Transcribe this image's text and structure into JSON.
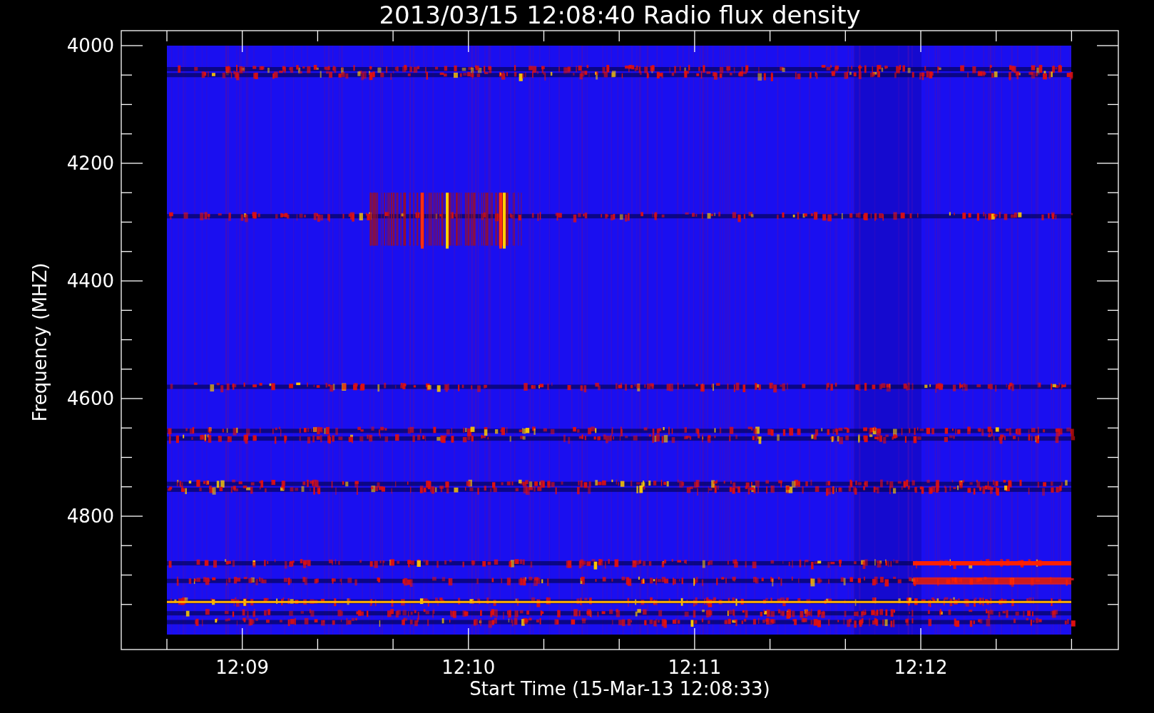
{
  "title": "2013/03/15 12:08:40 Radio flux density",
  "y_axis": {
    "title": "Frequency (MHZ)",
    "ticks": [
      "4000",
      "4200",
      "4400",
      "4600",
      "4800"
    ]
  },
  "x_axis": {
    "title": "Start Time (15-Mar-13 12:08:33)",
    "ticks": [
      "12:09",
      "12:10",
      "12:11",
      "12:12"
    ]
  }
}
